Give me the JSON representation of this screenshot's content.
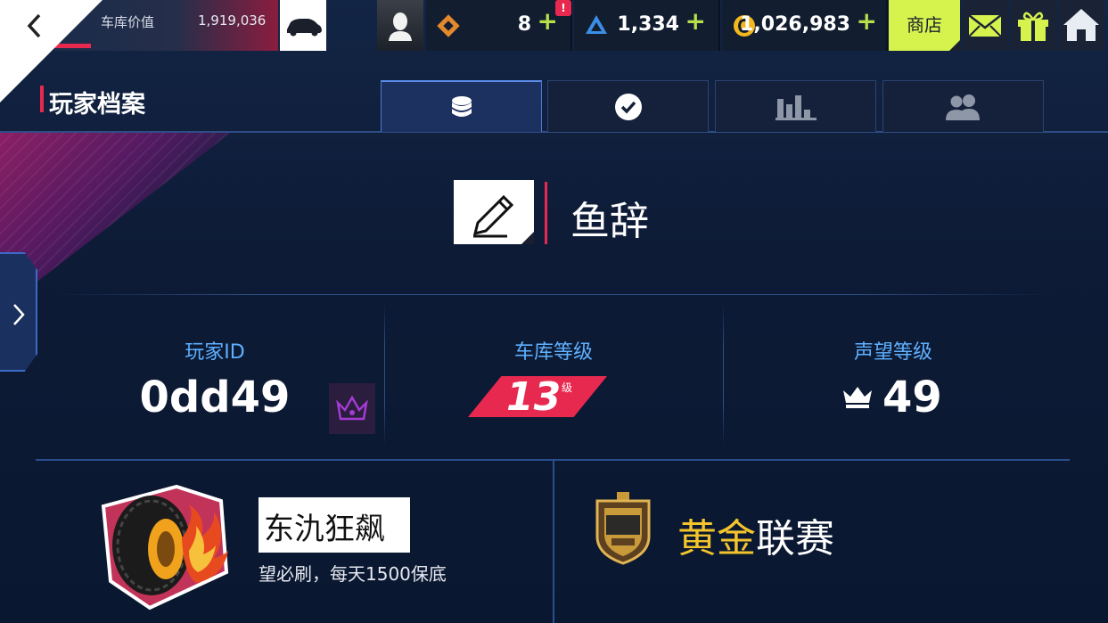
{
  "topbar": {
    "garage_value_label": "车库价值",
    "garage_value": "1,919,036",
    "alert_badge": "!",
    "currencies": [
      {
        "name": "token",
        "amount": "8",
        "color": "#e3882d"
      },
      {
        "name": "blueprint",
        "amount": "1,334",
        "color": "#3b8ee6"
      },
      {
        "name": "credits",
        "amount": "1,026,983",
        "color": "#f2b81e"
      }
    ],
    "plus_symbol": "+",
    "shop_label": "商店",
    "accent_color": "#d6f24d"
  },
  "header": {
    "title": "玩家档案"
  },
  "tabs": [
    {
      "name": "profile",
      "icon": "coins-stack-icon",
      "active": true
    },
    {
      "name": "achievements",
      "icon": "checkmark-icon",
      "active": false
    },
    {
      "name": "stats",
      "icon": "bar-chart-icon",
      "active": false
    },
    {
      "name": "friends",
      "icon": "friends-icon",
      "active": false
    }
  ],
  "player": {
    "name": "鱼辞"
  },
  "stats": {
    "player_id_label": "玩家ID",
    "player_id": "0dd49",
    "garage_level_label": "车库等级",
    "garage_level": "13",
    "garage_level_unit": "级",
    "prestige_label": "声望等级",
    "prestige_level": "49"
  },
  "club": {
    "name": "东氿狂飙",
    "motto": "望必刷，每天1500保底"
  },
  "league": {
    "name_highlight": "黄金",
    "name_rest": "联赛"
  }
}
